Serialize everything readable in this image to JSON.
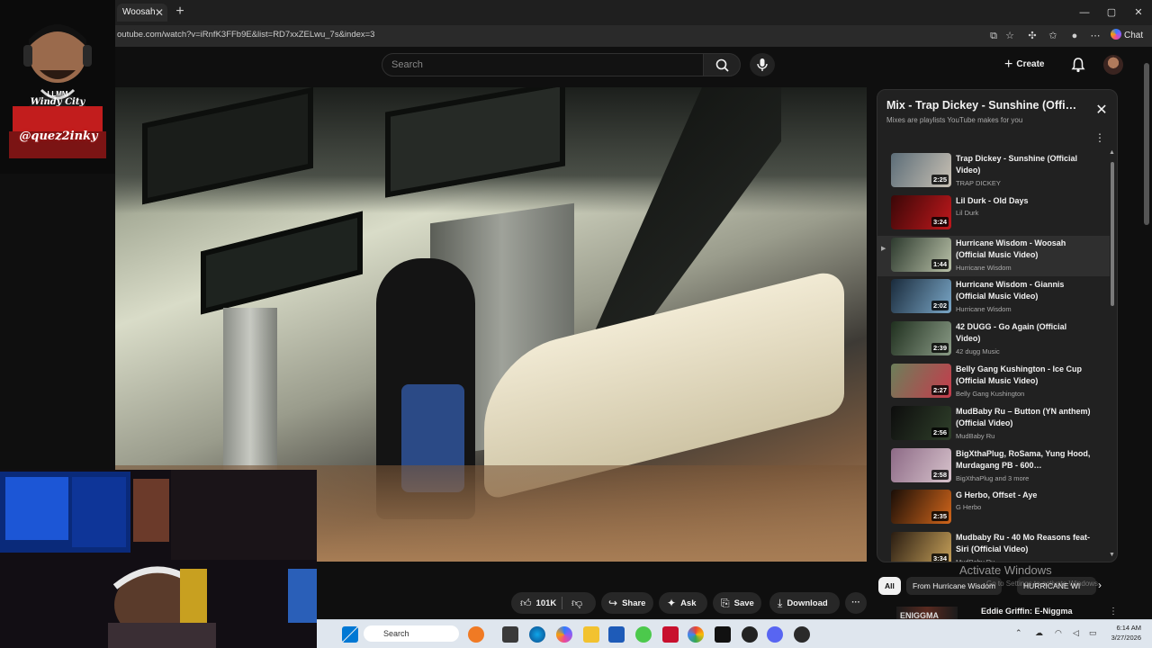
{
  "browser": {
    "tab_title": "Woosah",
    "tab_close": "✕",
    "new_tab": "+",
    "url": "outube.com/watch?v=iRnfK3FFb9E&list=RD7xxZELwu_7s&index=3",
    "chat_label": "Chat",
    "window_controls": [
      "—",
      "▢",
      "✕"
    ]
  },
  "header": {
    "search_placeholder": "Search",
    "create_label": "Create"
  },
  "overlay": {
    "badge_line1": "LLMM",
    "badge_line2": "Windy City",
    "tag": "@quez2inky"
  },
  "playlist": {
    "title": "Mix - Trap Dickey - Sunshine (Official Music Video)",
    "subtitle": "Mixes are playlists YouTube makes for you",
    "items": [
      {
        "title": "Trap Dickey - Sunshine (Official Video)",
        "channel": "TRAP DICKEY",
        "duration": "2:25",
        "c1": "#5c6d78",
        "c2": "#c9c1b4"
      },
      {
        "title": "Lil Durk - Old Days",
        "channel": "Lil Durk",
        "duration": "3:24",
        "c1": "#3a0707",
        "c2": "#c0181c"
      },
      {
        "title": "Hurricane Wisdom - Woosah (Official Music Video)",
        "channel": "Hurricane Wisdom",
        "duration": "1:44",
        "c1": "#2d3a2e",
        "c2": "#b9c1a8",
        "active": true
      },
      {
        "title": "Hurricane Wisdom - Giannis (Official Music Video)",
        "channel": "Hurricane Wisdom",
        "duration": "2:02",
        "c1": "#1a2b3c",
        "c2": "#7aa7c7"
      },
      {
        "title": "42 DUGG - Go Again (Official Video)",
        "channel": "42 dugg Music",
        "duration": "2:39",
        "c1": "#20301f",
        "c2": "#8a9b86"
      },
      {
        "title": "Belly Gang Kushington - Ice Cup (Official Music Video)",
        "channel": "Belly Gang Kushington",
        "duration": "2:27",
        "c1": "#6c7f5a",
        "c2": "#c63b4c"
      },
      {
        "title": "MudBaby Ru – Button (YN anthem) (Official Video)",
        "channel": "MudBaby Ru",
        "duration": "2:56",
        "c1": "#0d0d0d",
        "c2": "#2f3f2a"
      },
      {
        "title": "BigXthaPlug, RoSama, Yung Hood, Murdagang PB - 600…",
        "channel": "BigXthaPlug and 3 more",
        "duration": "2:58",
        "c1": "#8d6a86",
        "c2": "#d7c3cc"
      },
      {
        "title": "G Herbo, Offset - Aye",
        "channel": "G Herbo",
        "duration": "2:35",
        "c1": "#1a0e07",
        "c2": "#d2661b"
      },
      {
        "title": "Mudbaby Ru - 40 Mo Reasons feat- Siri (Official Video)",
        "channel": "MudBaby Ru",
        "duration": "3:34",
        "c1": "#2a1d12",
        "c2": "#c8a25a"
      }
    ]
  },
  "actions": {
    "likes": "101K",
    "share": "Share",
    "ask": "Ask",
    "save": "Save",
    "download": "Download",
    "more": "···"
  },
  "chips": {
    "all": "All",
    "from": "From Hurricane Wisdom",
    "third": "HURRICANE WI"
  },
  "next_video": "Eddie Griffin: E-Niggma",
  "next_thumb_text": "ENIGGMA",
  "watermark": {
    "line1": "Activate Windows",
    "line2": "Go to Settings to activate Windows."
  },
  "taskbar": {
    "search": "Search",
    "time": "6:14 AM",
    "date": "3/27/2026"
  }
}
